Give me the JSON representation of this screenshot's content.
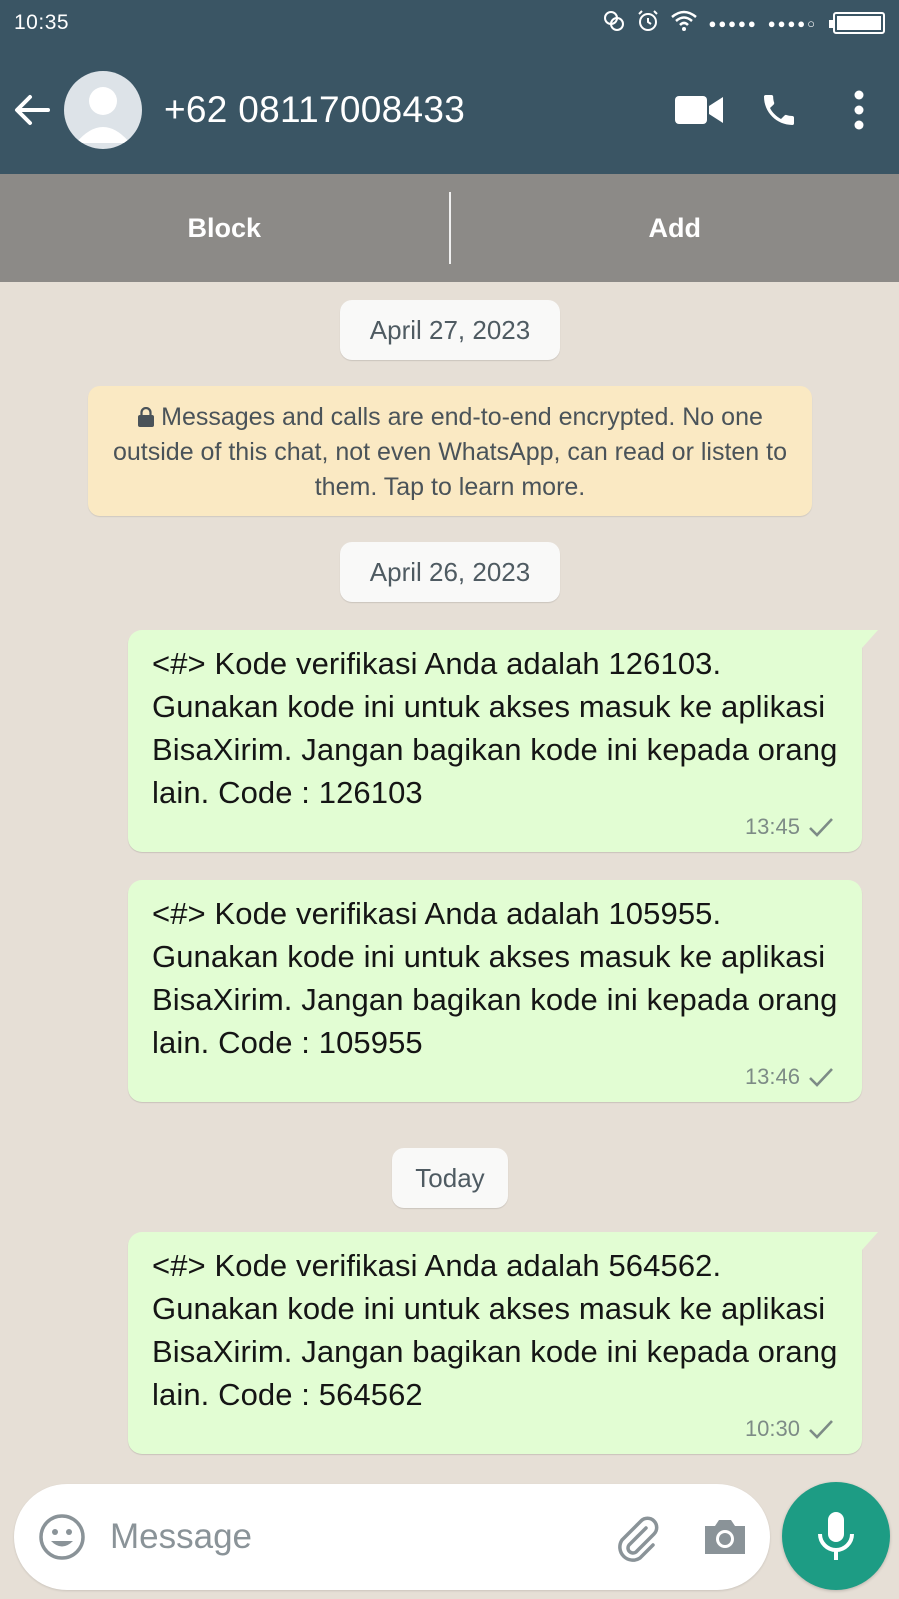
{
  "status_bar": {
    "time": "10:35",
    "signal_1": "●●●●●",
    "signal_2": "●●●●○"
  },
  "header": {
    "contact_name": "+62 08117008433",
    "icons": [
      "back-arrow-icon",
      "avatar",
      "video-call-icon",
      "phone-icon",
      "more-vert-icon"
    ]
  },
  "action_bar": {
    "block_label": "Block",
    "add_label": "Add"
  },
  "chat": {
    "date_1": "April 27, 2023",
    "encryption_notice": "🔒 Messages and calls are end-to-end encrypted. No one outside of this chat, not even WhatsApp, can read or listen to them. Tap to learn more.",
    "encryption_text": "Messages and calls are end-to-end encrypted. No one outside of this chat, not even WhatsApp, can read or listen to them. Tap to learn more.",
    "date_2": "April 26, 2023",
    "date_3": "Today",
    "messages": [
      {
        "text": "<#> Kode verifikasi Anda adalah 126103. Gunakan kode ini untuk akses masuk ke aplikasi BisaXirim. Jangan bagikan kode ini kepada orang lain. Code : 126103",
        "time": "13:45",
        "status": "sent"
      },
      {
        "text": "<#> Kode verifikasi Anda adalah 105955. Gunakan kode ini untuk akses masuk ke aplikasi BisaXirim. Jangan bagikan kode ini kepada orang lain. Code : 105955",
        "time": "13:46",
        "status": "sent"
      },
      {
        "text": "<#> Kode verifikasi Anda adalah 564562. Gunakan kode ini untuk akses masuk ke aplikasi BisaXirim. Jangan bagikan kode ini kepada orang lain. Code : 564562",
        "time": "10:30",
        "status": "sent"
      }
    ]
  },
  "composer": {
    "placeholder": "Message"
  },
  "colors": {
    "header": "#3a5564",
    "action_bar": "#8c8a87",
    "chat_bg": "#e6dfd6",
    "bubble": "#e2fdd3",
    "notice": "#fae9c3",
    "mic": "#1d9c84"
  }
}
